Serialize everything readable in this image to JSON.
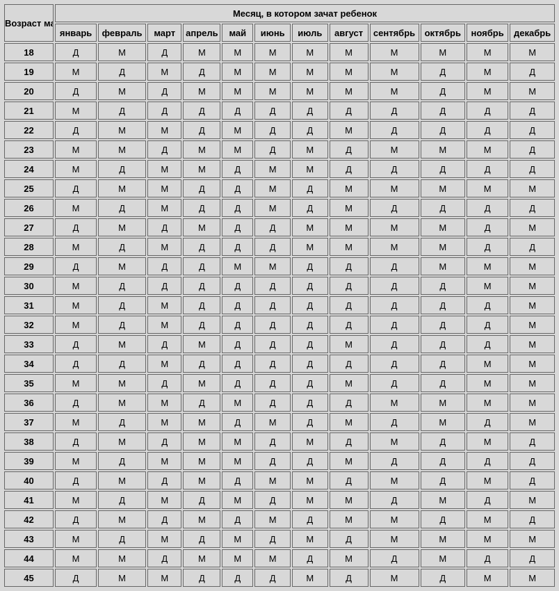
{
  "header": {
    "age_label": "Возраст матери",
    "months_title": "Месяц, в котором зачат ребенок",
    "months": [
      "январь",
      "февраль",
      "март",
      "апрель",
      "май",
      "июнь",
      "июль",
      "август",
      "сентябрь",
      "октябрь",
      "ноябрь",
      "декабрь"
    ]
  },
  "rows": [
    {
      "age": "18",
      "cells": [
        "Д",
        "М",
        "Д",
        "М",
        "М",
        "М",
        "М",
        "М",
        "М",
        "М",
        "М",
        "М"
      ]
    },
    {
      "age": "19",
      "cells": [
        "М",
        "Д",
        "М",
        "Д",
        "М",
        "М",
        "М",
        "М",
        "М",
        "Д",
        "М",
        "Д"
      ]
    },
    {
      "age": "20",
      "cells": [
        "Д",
        "М",
        "Д",
        "М",
        "М",
        "М",
        "М",
        "М",
        "М",
        "Д",
        "М",
        "М"
      ]
    },
    {
      "age": "21",
      "cells": [
        "М",
        "Д",
        "Д",
        "Д",
        "Д",
        "Д",
        "Д",
        "Д",
        "Д",
        "Д",
        "Д",
        "Д"
      ]
    },
    {
      "age": "22",
      "cells": [
        "Д",
        "М",
        "М",
        "Д",
        "М",
        "Д",
        "Д",
        "М",
        "Д",
        "Д",
        "Д",
        "Д"
      ]
    },
    {
      "age": "23",
      "cells": [
        "М",
        "М",
        "Д",
        "М",
        "М",
        "Д",
        "М",
        "Д",
        "М",
        "М",
        "М",
        "Д"
      ]
    },
    {
      "age": "24",
      "cells": [
        "М",
        "Д",
        "М",
        "М",
        "Д",
        "М",
        "М",
        "Д",
        "Д",
        "Д",
        "Д",
        "Д"
      ]
    },
    {
      "age": "25",
      "cells": [
        "Д",
        "М",
        "М",
        "Д",
        "Д",
        "М",
        "Д",
        "М",
        "М",
        "М",
        "М",
        "М"
      ]
    },
    {
      "age": "26",
      "cells": [
        "М",
        "Д",
        "М",
        "Д",
        "Д",
        "М",
        "Д",
        "М",
        "Д",
        "Д",
        "Д",
        "Д"
      ]
    },
    {
      "age": "27",
      "cells": [
        "Д",
        "М",
        "Д",
        "М",
        "Д",
        "Д",
        "М",
        "М",
        "М",
        "М",
        "Д",
        "М"
      ]
    },
    {
      "age": "28",
      "cells": [
        "М",
        "Д",
        "М",
        "Д",
        "Д",
        "Д",
        "М",
        "М",
        "М",
        "М",
        "Д",
        "Д"
      ]
    },
    {
      "age": "29",
      "cells": [
        "Д",
        "М",
        "Д",
        "Д",
        "М",
        "М",
        "Д",
        "Д",
        "Д",
        "М",
        "М",
        "М"
      ]
    },
    {
      "age": "30",
      "cells": [
        "М",
        "Д",
        "Д",
        "Д",
        "Д",
        "Д",
        "Д",
        "Д",
        "Д",
        "Д",
        "М",
        "М"
      ]
    },
    {
      "age": "31",
      "cells": [
        "М",
        "Д",
        "М",
        "Д",
        "Д",
        "Д",
        "Д",
        "Д",
        "Д",
        "Д",
        "Д",
        "М"
      ]
    },
    {
      "age": "32",
      "cells": [
        "М",
        "Д",
        "М",
        "Д",
        "Д",
        "Д",
        "Д",
        "Д",
        "Д",
        "Д",
        "Д",
        "М"
      ]
    },
    {
      "age": "33",
      "cells": [
        "Д",
        "М",
        "Д",
        "М",
        "Д",
        "Д",
        "Д",
        "М",
        "Д",
        "Д",
        "Д",
        "М"
      ]
    },
    {
      "age": "34",
      "cells": [
        "Д",
        "Д",
        "М",
        "Д",
        "Д",
        "Д",
        "Д",
        "Д",
        "Д",
        "Д",
        "М",
        "М"
      ]
    },
    {
      "age": "35",
      "cells": [
        "М",
        "М",
        "Д",
        "М",
        "Д",
        "Д",
        "Д",
        "М",
        "Д",
        "Д",
        "М",
        "М"
      ]
    },
    {
      "age": "36",
      "cells": [
        "Д",
        "М",
        "М",
        "Д",
        "М",
        "Д",
        "Д",
        "Д",
        "М",
        "М",
        "М",
        "М"
      ]
    },
    {
      "age": "37",
      "cells": [
        "М",
        "Д",
        "М",
        "М",
        "Д",
        "М",
        "Д",
        "М",
        "Д",
        "М",
        "Д",
        "М"
      ]
    },
    {
      "age": "38",
      "cells": [
        "Д",
        "М",
        "Д",
        "М",
        "М",
        "Д",
        "М",
        "Д",
        "М",
        "Д",
        "М",
        "Д"
      ]
    },
    {
      "age": "39",
      "cells": [
        "М",
        "Д",
        "М",
        "М",
        "М",
        "Д",
        "Д",
        "М",
        "Д",
        "Д",
        "Д",
        "Д"
      ]
    },
    {
      "age": "40",
      "cells": [
        "Д",
        "М",
        "Д",
        "М",
        "Д",
        "М",
        "М",
        "Д",
        "М",
        "Д",
        "М",
        "Д"
      ]
    },
    {
      "age": "41",
      "cells": [
        "М",
        "Д",
        "М",
        "Д",
        "М",
        "Д",
        "М",
        "М",
        "Д",
        "М",
        "Д",
        "М"
      ]
    },
    {
      "age": "42",
      "cells": [
        "Д",
        "М",
        "Д",
        "М",
        "Д",
        "М",
        "Д",
        "М",
        "М",
        "Д",
        "М",
        "Д"
      ]
    },
    {
      "age": "43",
      "cells": [
        "М",
        "Д",
        "М",
        "Д",
        "М",
        "Д",
        "М",
        "Д",
        "М",
        "М",
        "М",
        "М"
      ]
    },
    {
      "age": "44",
      "cells": [
        "М",
        "М",
        "Д",
        "М",
        "М",
        "М",
        "Д",
        "М",
        "Д",
        "М",
        "Д",
        "Д"
      ]
    },
    {
      "age": "45",
      "cells": [
        "Д",
        "М",
        "М",
        "Д",
        "Д",
        "Д",
        "М",
        "Д",
        "М",
        "Д",
        "М",
        "М"
      ]
    }
  ]
}
